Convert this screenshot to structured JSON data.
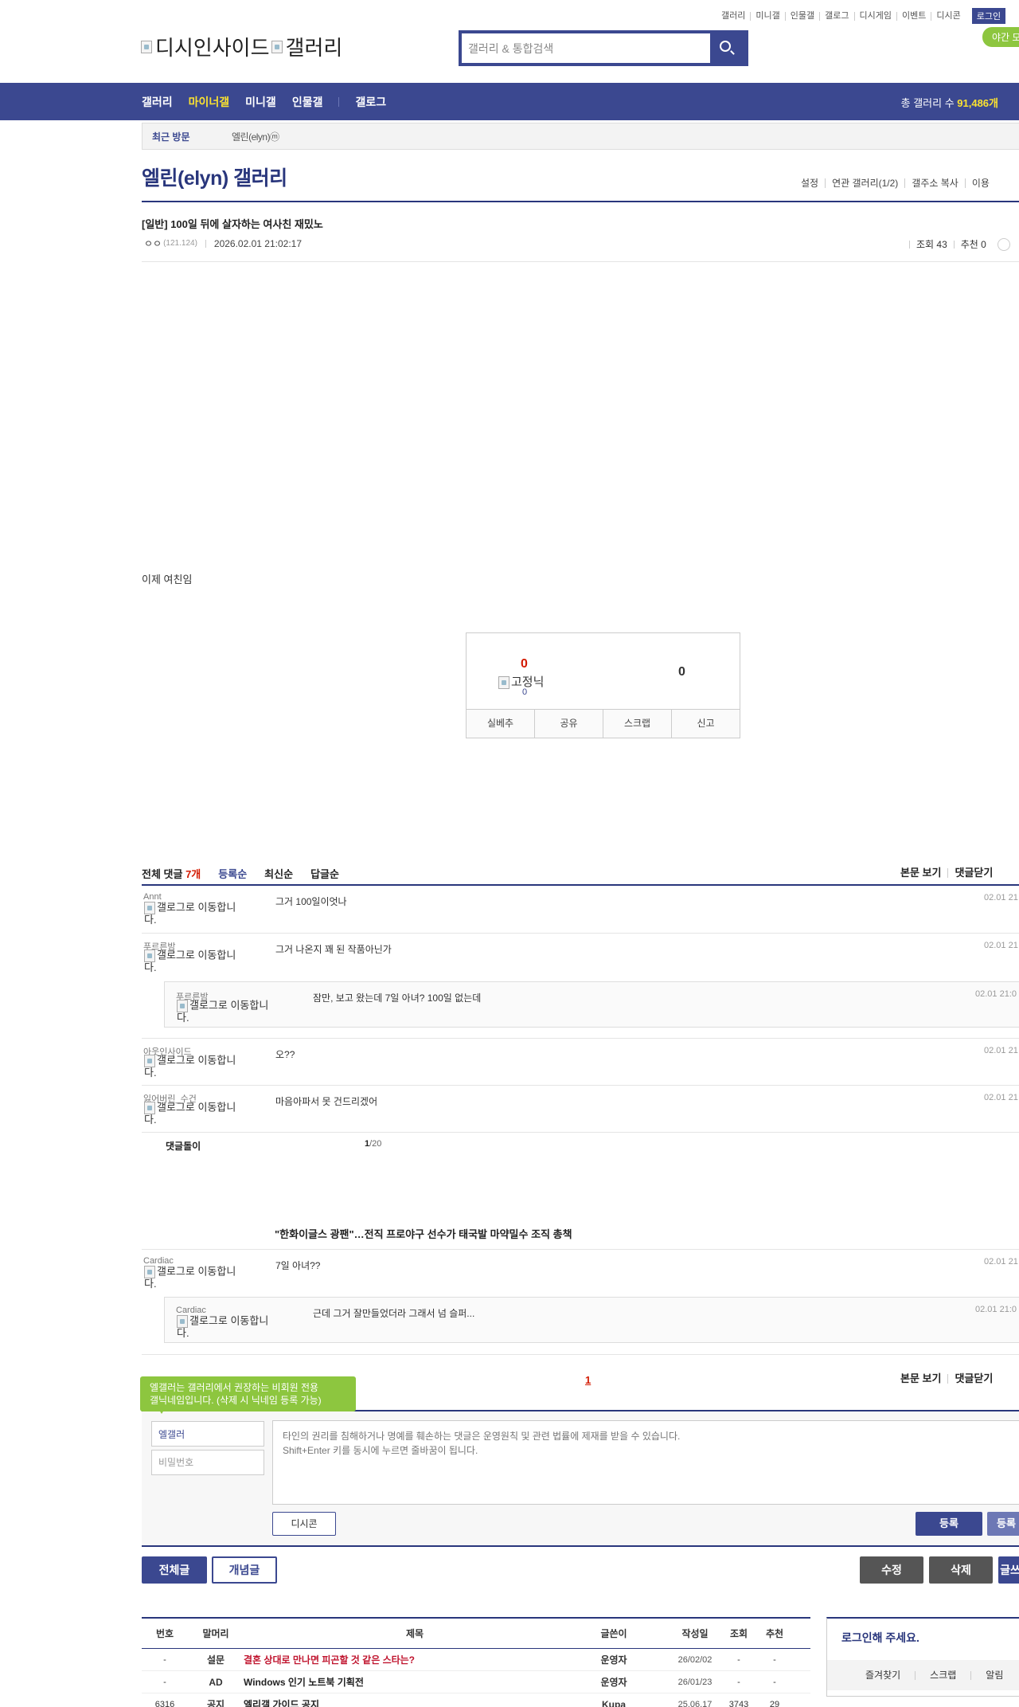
{
  "top_links": [
    "갤러리",
    "미니갤",
    "인물갤",
    "갤로그",
    "디시게임",
    "이벤트",
    "디시콘"
  ],
  "login_label": "로그인",
  "night_mode_label": "야간 모드",
  "logo_alt_1": "디시인사이드",
  "logo_alt_2": "갤러리",
  "search": {
    "placeholder": "갤러리 & 통합검색"
  },
  "nav": {
    "items": [
      "갤러리",
      "마이너갤",
      "미니갤",
      "인물갤",
      "갤로그"
    ],
    "total_label": "총 갤러리 수 ",
    "total_value": "91,486개"
  },
  "recent": {
    "title": "최근 방문",
    "item": "엘린(elyn)ⓜ"
  },
  "gallery": {
    "title": "엘린(elyn) 갤러리",
    "tools": [
      "설정",
      "연관 갤러리(1/2)",
      "갤주소 복사",
      "이용"
    ]
  },
  "post": {
    "title": "[일반] 100일 뒤에 살자하는 여사친 재밌노",
    "author": "ㅇㅇ",
    "ip": "(121.124)",
    "date": "2026.02.01 21:02:17",
    "views": "조회 43",
    "recommend": "추천 0",
    "body": "이제 여친임"
  },
  "reco": {
    "up": "0",
    "nick_alt": "고정닉",
    "fix": "0",
    "down": "0",
    "buttons": [
      "실베추",
      "공유",
      "스크랩",
      "신고"
    ]
  },
  "comments_head": {
    "label": "전체 댓글 ",
    "count": "7개",
    "sorts": [
      "등록순",
      "최신순",
      "답글순"
    ],
    "right": [
      "본문 보기",
      "댓글닫기"
    ]
  },
  "gallog_alt": "갤로그로 이동합니다.",
  "comments": [
    {
      "nick": "Annt",
      "text": "그거 100일이엇나",
      "date": "02.01 21"
    },
    {
      "nick": "푸르른밤",
      "text": "그거 나온지 꽤 된 작품아닌가",
      "date": "02.01 21"
    },
    {
      "nick": "푸르른밤",
      "text": "잠만, 보고 왔는데 7일 아녀? 100일 없는데",
      "date": "02.01 21:0"
    },
    {
      "nick": "아웃인사이드",
      "text": "오??",
      "date": "02.01 21"
    },
    {
      "nick": "잃어버린_수건",
      "text": "마음아파서 못 건드리겠어",
      "date": "02.01 21"
    },
    {
      "nick": "Cardiac",
      "text": "7일 아녀??",
      "date": "02.01 21"
    },
    {
      "nick": "Cardiac",
      "text": "근데 그거 잘만들었더라 그래서 넘 슬퍼...",
      "date": "02.01 21:0"
    }
  ],
  "dolbot": {
    "label": "댓글돌이",
    "page": "1",
    "total": "/20"
  },
  "news": "\"한화이글스 광팬\"…전직 프로야구 선수가 태국발 마약밀수 조직 총책",
  "comment_foot": {
    "page": "1",
    "right": [
      "본문 보기",
      "댓글닫기"
    ]
  },
  "tooltip": "엘갤러는 갤러리에서 권장하는 비회원 전용\n갤닉네임입니다. (삭제 시 닉네임 등록 가능)",
  "write": {
    "name_value": "엘갤러",
    "password_placeholder": "비밀번호",
    "text_placeholder": "타인의 권리를 침해하거나 명예를 훼손하는 댓글은 운영원칙 및 관련 법률에 제재를 받을 수 있습니다.\nShift+Enter 키를 동시에 누르면 줄바꿈이 됩니다.",
    "dccon": "디시콘",
    "register": "등록",
    "register2": "등록"
  },
  "bottom_buttons": {
    "all": "전체글",
    "concept": "개념글",
    "edit": "수정",
    "delete": "삭제",
    "write": "글쓰기"
  },
  "list": {
    "headers": [
      "번호",
      "말머리",
      "제목",
      "글쓴이",
      "작성일",
      "조회",
      "추천"
    ],
    "rows": [
      {
        "num": "-",
        "head": "설문",
        "title": "결혼 상대로 만나면 피곤할 것 같은 스타는?",
        "writer": "운영자",
        "date": "26/02/02",
        "views": "-",
        "reco": "-"
      },
      {
        "num": "-",
        "head": "AD",
        "title": "Windows 인기 노트북 기획전",
        "writer": "운영자",
        "date": "26/01/23",
        "views": "-",
        "reco": "-"
      },
      {
        "num": "6316",
        "head": "공지",
        "title": "엘리갤 가이드 공지",
        "writer": "Kupa",
        "date": "25.06.17",
        "views": "3743",
        "reco": "29"
      }
    ]
  },
  "login_box": {
    "title": "로그인해 주세요.",
    "links": [
      "즐겨찾기",
      "스크랩",
      "알림"
    ]
  }
}
